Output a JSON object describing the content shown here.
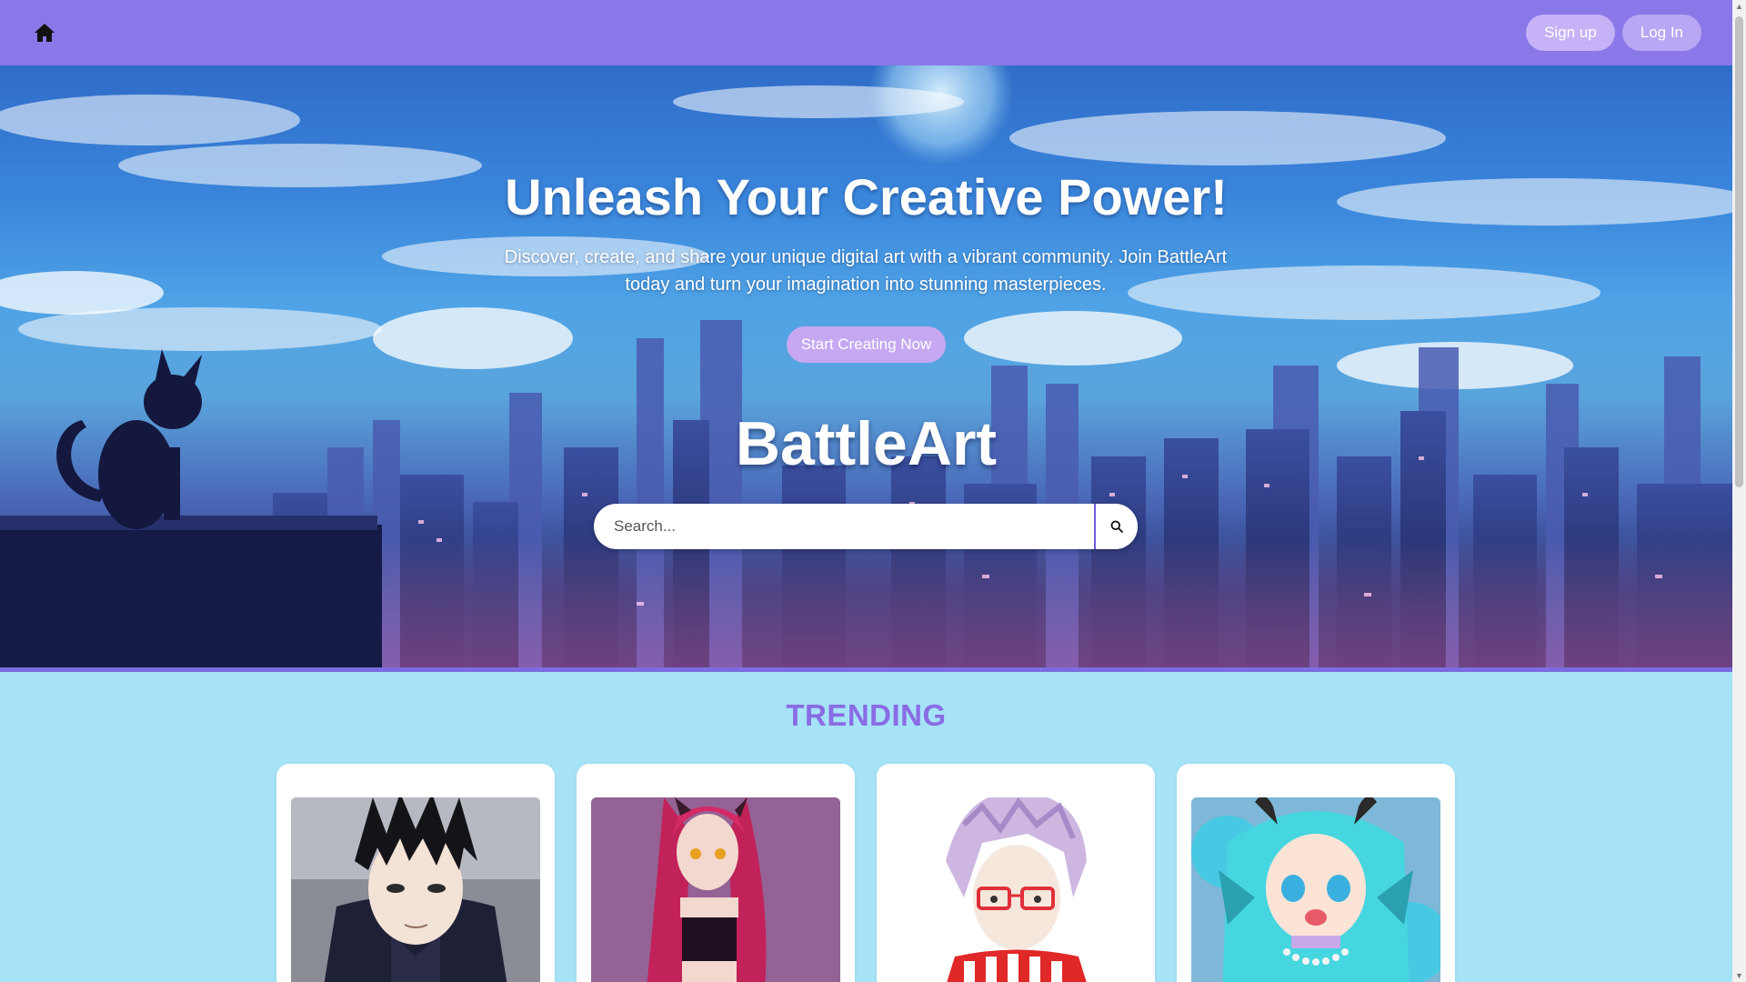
{
  "header": {
    "home_icon": "home-icon",
    "signup_label": "Sign up",
    "login_label": "Log In"
  },
  "hero": {
    "title": "Unleash Your Creative Power!",
    "description": "Discover, create, and share your unique digital art with a vibrant community. Join BattleArt today and turn your imagination into stunning masterpieces.",
    "cta_label": "Start Creating Now",
    "brand": "BattleArt",
    "search": {
      "placeholder": "Search...",
      "value": "",
      "icon": "search-icon"
    }
  },
  "trending": {
    "title": "TRENDING",
    "cards": [
      {
        "art": "dark-haired anime boy in dark uniform"
      },
      {
        "art": "red-haired anime girl with horns"
      },
      {
        "art": "lavender-haired character with red glasses and striped scarf"
      },
      {
        "art": "teal-haired fin-eared anime girl with pearl necklace"
      }
    ]
  },
  "colors": {
    "header_bg": "#8a78e8",
    "accent": "#8a6ce4",
    "page_bg": "#a6e3f7",
    "button_bg": "#c6b2f6"
  }
}
